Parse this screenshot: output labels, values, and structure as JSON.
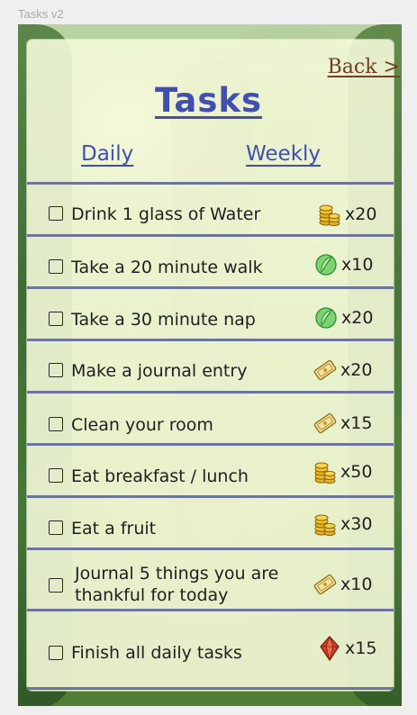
{
  "window": {
    "title": "Tasks v2"
  },
  "header": {
    "back_label": "Back >",
    "title": "Tasks"
  },
  "tabs": [
    {
      "label": "Daily"
    },
    {
      "label": "Weekly"
    }
  ],
  "tasks": [
    {
      "label": "Drink 1 glass of Water",
      "reward_icon": "coins-icon",
      "reward_qty": "x20"
    },
    {
      "label": "Take a 20 minute walk",
      "reward_icon": "leaf-icon",
      "reward_qty": "x10"
    },
    {
      "label": "Take a 30 minute nap",
      "reward_icon": "leaf-icon",
      "reward_qty": "x20"
    },
    {
      "label": "Make a journal entry",
      "reward_icon": "ticket-icon",
      "reward_qty": "x20"
    },
    {
      "label": "Clean your room",
      "reward_icon": "ticket-icon",
      "reward_qty": "x15"
    },
    {
      "label": "Eat breakfast / lunch",
      "reward_icon": "coins-icon",
      "reward_qty": "x50"
    },
    {
      "label": "Eat a fruit",
      "reward_icon": "coins-icon",
      "reward_qty": "x30"
    },
    {
      "label_line1": "Journal 5 things you are",
      "label_line2": "thankful for today",
      "reward_icon": "ticket-icon",
      "reward_qty": "x10"
    },
    {
      "label": "Finish all daily tasks",
      "reward_icon": "gem-icon",
      "reward_qty": "x15"
    }
  ],
  "colors": {
    "accent": "#3f4fb4",
    "back_link": "#6d3f25",
    "divider": "#6c7598"
  }
}
